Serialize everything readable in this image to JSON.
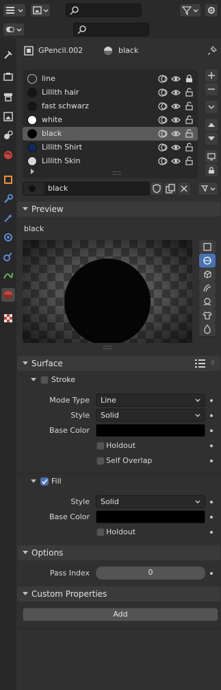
{
  "header": {
    "search_placeholder_top": "",
    "search_placeholder_second": ""
  },
  "context": {
    "object_name": "GPencil.002",
    "material_name": "black"
  },
  "slots": [
    {
      "name": "line",
      "swatch": "#202020",
      "outline": true,
      "locked": true
    },
    {
      "name": "Lillith hair",
      "swatch": "#151515",
      "outline": false,
      "locked": false
    },
    {
      "name": "fast  schwarz",
      "swatch": "#151515",
      "outline": false,
      "locked": false
    },
    {
      "name": "white",
      "swatch": "#ffffff",
      "outline": false,
      "locked": false
    },
    {
      "name": "black",
      "swatch": "#000000",
      "outline": false,
      "locked": false,
      "selected": true
    },
    {
      "name": "Lillith Shirt",
      "swatch": "#0c2a55",
      "outline": false,
      "locked": false
    },
    {
      "name": "Lillith Skin",
      "swatch": "#d8d8d8",
      "outline": false,
      "locked": false
    }
  ],
  "material_field": {
    "value": "black"
  },
  "preview": {
    "section": "Preview",
    "material_label": "black"
  },
  "surface": {
    "section": "Surface",
    "stroke": {
      "label": "Stroke",
      "enabled": false,
      "mode_type_label": "Mode Type",
      "mode_type_value": "Line",
      "style_label": "Style",
      "style_value": "Solid",
      "base_color_label": "Base Color",
      "base_color": "#000000",
      "holdout_label": "Holdout",
      "self_overlap_label": "Self Overlap"
    },
    "fill": {
      "label": "Fill",
      "enabled": true,
      "style_label": "Style",
      "style_value": "Solid",
      "base_color_label": "Base Color",
      "base_color": "#000000",
      "holdout_label": "Holdout"
    }
  },
  "options": {
    "section": "Options",
    "pass_index_label": "Pass Index",
    "pass_index_value": "0"
  },
  "custom_properties": {
    "section": "Custom Properties",
    "add_label": "Add"
  },
  "colors": {
    "accent": "#4772b3",
    "panel": "#303030",
    "header": "#3a3a3a"
  }
}
